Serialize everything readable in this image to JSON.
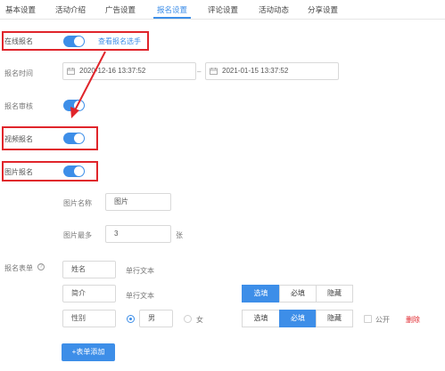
{
  "tabs": [
    {
      "label": "基本设置"
    },
    {
      "label": "活动介绍"
    },
    {
      "label": "广告设置"
    },
    {
      "label": "报名设置"
    },
    {
      "label": "评论设置"
    },
    {
      "label": "活动动态"
    },
    {
      "label": "分享设置"
    }
  ],
  "active_tab": "报名设置",
  "online_signup": {
    "label": "在线报名",
    "enabled": true,
    "link": "查看报名选手"
  },
  "signup_time": {
    "label": "报名时间",
    "start": "2020-12-16 13:37:52",
    "separator": "–",
    "end": "2021-01-15 13:37:52"
  },
  "signup_review": {
    "label": "报名审核",
    "enabled": true
  },
  "video_signup": {
    "label": "视频报名",
    "enabled": true
  },
  "image_signup": {
    "label": "图片报名",
    "enabled": true
  },
  "image_name": {
    "label": "图片名称",
    "value": "图片"
  },
  "image_max": {
    "label": "图片最多",
    "value": "3",
    "unit": "张"
  },
  "signup_form": {
    "label": "报名表单",
    "help_icon": "question-icon",
    "rows": [
      {
        "name": "姓名",
        "type": "单行文本"
      },
      {
        "name": "简介",
        "type": "单行文本",
        "options": [
          "选填",
          "必填",
          "隐藏"
        ],
        "selected": "选填"
      },
      {
        "name": "性别",
        "radio_a": "男",
        "radio_b": "女",
        "radio_selected": "男",
        "options": [
          "选填",
          "必填",
          "隐藏"
        ],
        "selected": "必填",
        "public_label": "公开",
        "public_checked": false,
        "delete_label": "删除"
      }
    ],
    "add_button": "+表单添加"
  },
  "colors": {
    "accent": "#3d8ee8",
    "annotation_red": "#e0252b"
  }
}
